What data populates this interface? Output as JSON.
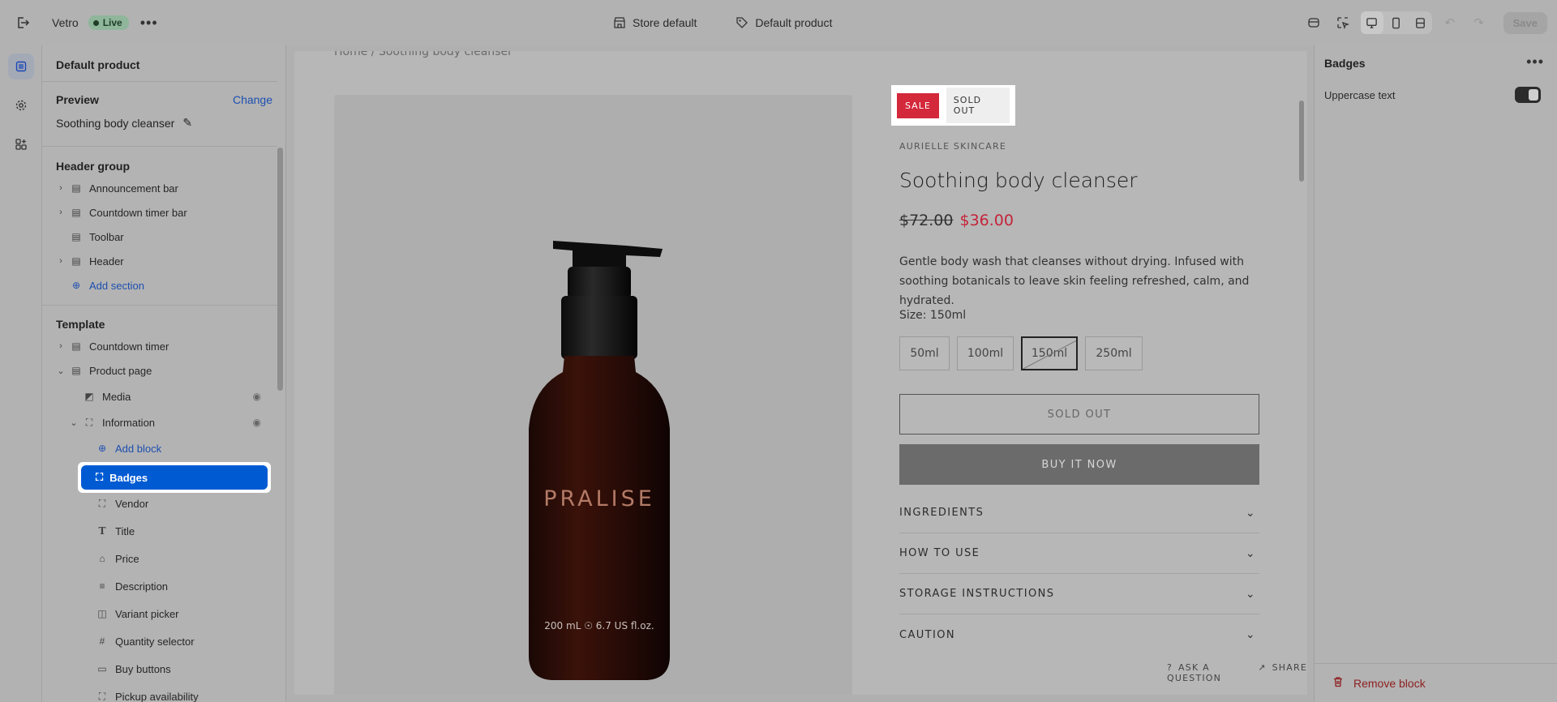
{
  "topbar": {
    "store_name": "Vetro",
    "live_label": "Live",
    "theme_label": "Store default",
    "template_label": "Default product",
    "save_label": "Save"
  },
  "sidebar": {
    "title": "Default product",
    "preview_label": "Preview",
    "change_label": "Change",
    "preview_value": "Soothing body cleanser",
    "header_group_title": "Header group",
    "header_items": [
      {
        "label": "Announcement bar"
      },
      {
        "label": "Countdown timer bar"
      },
      {
        "label": "Toolbar"
      },
      {
        "label": "Header"
      }
    ],
    "add_section_label": "Add section",
    "template_title": "Template",
    "template_items": [
      {
        "label": "Countdown timer"
      },
      {
        "label": "Product page"
      },
      {
        "label": "Media"
      },
      {
        "label": "Information"
      }
    ],
    "add_block_label": "Add block",
    "blocks": [
      {
        "label": "Badges"
      },
      {
        "label": "Vendor"
      },
      {
        "label": "Title"
      },
      {
        "label": "Price"
      },
      {
        "label": "Description"
      },
      {
        "label": "Variant picker"
      },
      {
        "label": "Quantity selector"
      },
      {
        "label": "Buy buttons"
      },
      {
        "label": "Pickup availability"
      }
    ]
  },
  "preview": {
    "breadcrumb": "Home  /  Soothing body cleanser",
    "badge_sale": "SALE",
    "badge_sold_out": "SOLD OUT",
    "vendor": "AURIELLE SKINCARE",
    "title": "Soothing body cleanser",
    "price_old": "$72.00",
    "price_new": "$36.00",
    "description": "Gentle body wash that cleanses without drying. Infused with soothing botanicals to leave skin feeling refreshed, calm, and hydrated.",
    "size_label": "Size: 150ml",
    "sizes": [
      "50ml",
      "100ml",
      "150ml",
      "250ml"
    ],
    "selected_size": "150ml",
    "sold_out_button": "SOLD OUT",
    "buy_now_button": "BUY IT NOW",
    "accordions": [
      "INGREDIENTS",
      "HOW TO USE",
      "STORAGE INSTRUCTIONS",
      "CAUTION"
    ],
    "ask_question": "ASK A QUESTION",
    "share": "SHARE",
    "bottle_brand": "PRALISE",
    "bottle_volume": "200 mL ☉ 6.7 US fl.oz."
  },
  "right_panel": {
    "title": "Badges",
    "option_label": "Uppercase text",
    "remove_label": "Remove block"
  },
  "colors": {
    "accent": "#005bd3",
    "sale": "#d4283b",
    "danger": "#8e1f1f"
  }
}
